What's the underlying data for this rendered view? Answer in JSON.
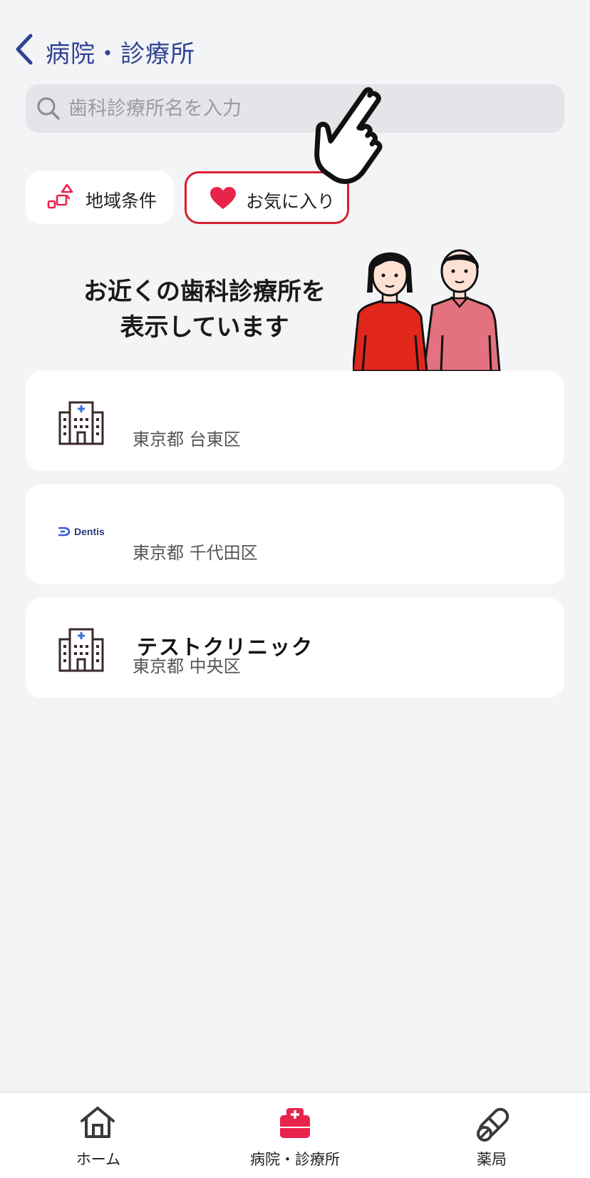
{
  "header": {
    "title": "病院・診療所"
  },
  "search": {
    "placeholder": "歯科診療所名を入力",
    "value": ""
  },
  "filters": {
    "region_label": "地域条件",
    "favorites_label": "お気に入り"
  },
  "banner": {
    "line1": "お近くの歯科診療所を",
    "line2": "表示しています"
  },
  "clinics": [
    {
      "name": "",
      "address": "東京都 台東区",
      "logo": "hospital-building-icon"
    },
    {
      "name": "",
      "address": "東京都 千代田区",
      "logo": "dentis-logo",
      "logo_text": "Dentis"
    },
    {
      "name": "テストクリニック",
      "address": "東京都 中央区",
      "logo": "hospital-building-icon"
    }
  ],
  "bottom_nav": {
    "home_label": "ホーム",
    "hospital_label": "病院・診療所",
    "pharmacy_label": "薬局",
    "active": "hospital"
  },
  "colors": {
    "accent_red": "#e8234c",
    "favorite_border": "#d9202f",
    "header_blue": "#2f4394",
    "background": "#f3f4f6"
  }
}
